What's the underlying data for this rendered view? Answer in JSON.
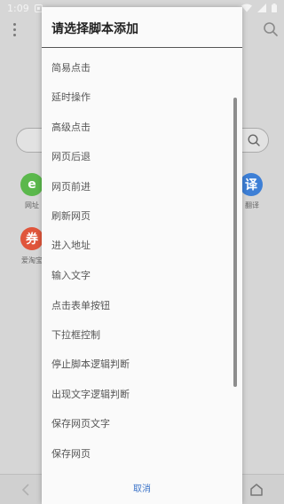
{
  "status_bar": {
    "time": "1:09"
  },
  "background": {
    "apps": [
      {
        "label": "网址",
        "glyph": "e",
        "color": "#5bb84c"
      },
      {
        "label": "翻译",
        "glyph": "译",
        "color": "#3d7fd6"
      },
      {
        "label": "爱淘宝",
        "glyph": "券",
        "color": "#e0553b"
      }
    ]
  },
  "dialog": {
    "title": "请选择脚本添加",
    "items": [
      "简易点击",
      "延时操作",
      "高级点击",
      "网页后退",
      "网页前进",
      "刷新网页",
      "进入地址",
      "输入文字",
      "点击表单按钮",
      "下拉框控制",
      "停止脚本逻辑判断",
      "出现文字逻辑判断",
      "保存网页文字",
      "保存网页"
    ],
    "cancel_label": "取消"
  }
}
